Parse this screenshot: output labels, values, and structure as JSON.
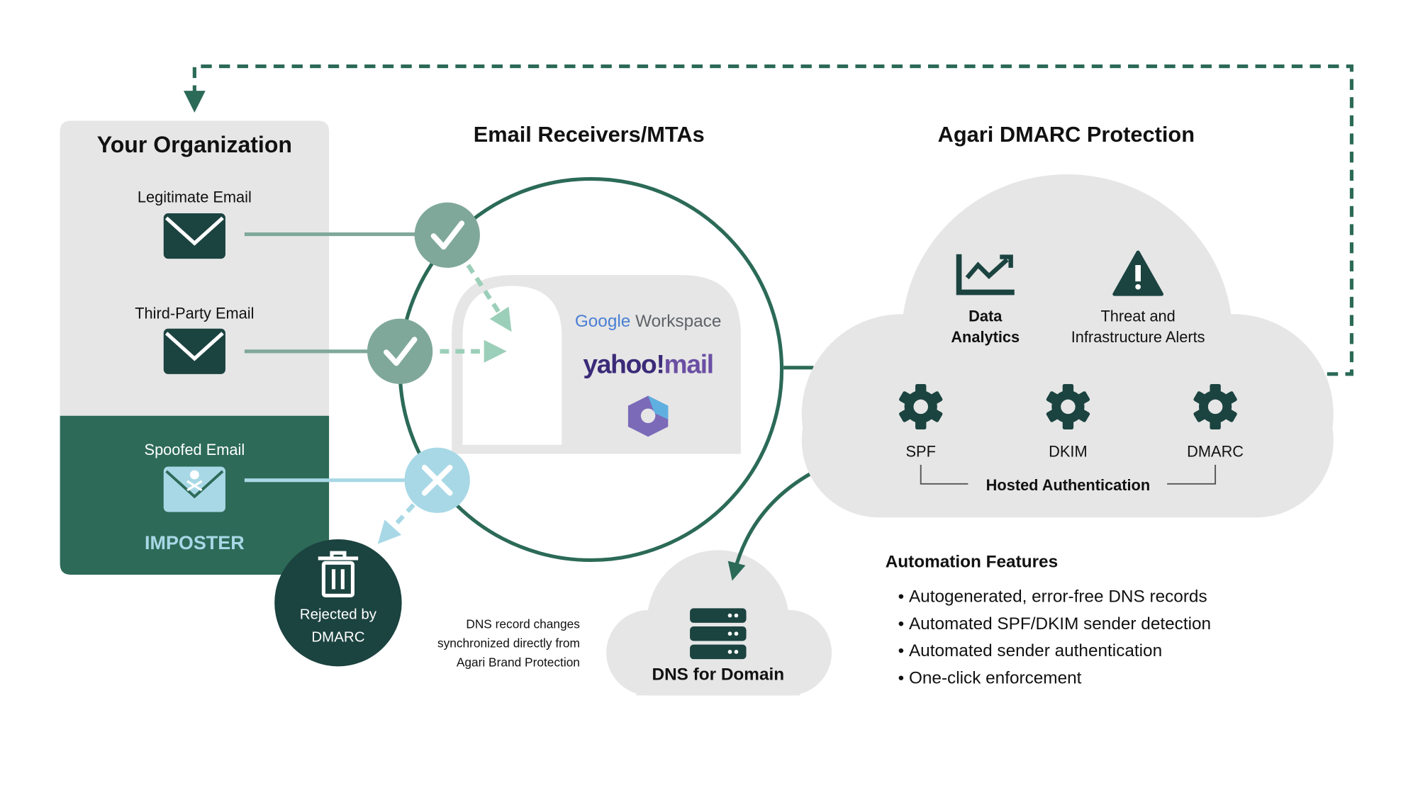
{
  "colors": {
    "dark_green": "#1b4340",
    "mid_green": "#2b6a57",
    "sage": "#7fa89b",
    "mint": "#9ccfb9",
    "light_blue": "#a8d8e6",
    "gray": "#e6e6e6"
  },
  "organization": {
    "title": "Your Organization",
    "legitimate": "Legitimate Email",
    "third_party": "Third-Party Email",
    "spoofed": "Spoofed Email",
    "imposter": "IMPOSTER"
  },
  "receivers": {
    "title": "Email Receivers/MTAs",
    "logos": [
      "Google Workspace",
      "yahoo!mail",
      "Microsoft 365"
    ],
    "google": "Google",
    "workspace": "Workspace",
    "yahoo": "yahoo!",
    "mail": "mail"
  },
  "rejected": {
    "line1": "Rejected by",
    "line2": "DMARC"
  },
  "dns_note": [
    "DNS record changes",
    "synchronized directly from",
    "Agari Brand Protection"
  ],
  "dns": {
    "label": "DNS for Domain"
  },
  "agari": {
    "title": "Agari DMARC Protection",
    "data_analytics": [
      "Data",
      "Analytics"
    ],
    "alerts": [
      "Threat and",
      "Infrastructure Alerts"
    ],
    "auth": [
      "SPF",
      "DKIM",
      "DMARC"
    ],
    "hosted": "Hosted Authentication"
  },
  "automation": {
    "title": "Automation Features",
    "items": [
      "Autogenerated, error-free DNS records",
      "Automated SPF/DKIM sender detection",
      "Automated sender authentication",
      "One-click enforcement"
    ]
  }
}
